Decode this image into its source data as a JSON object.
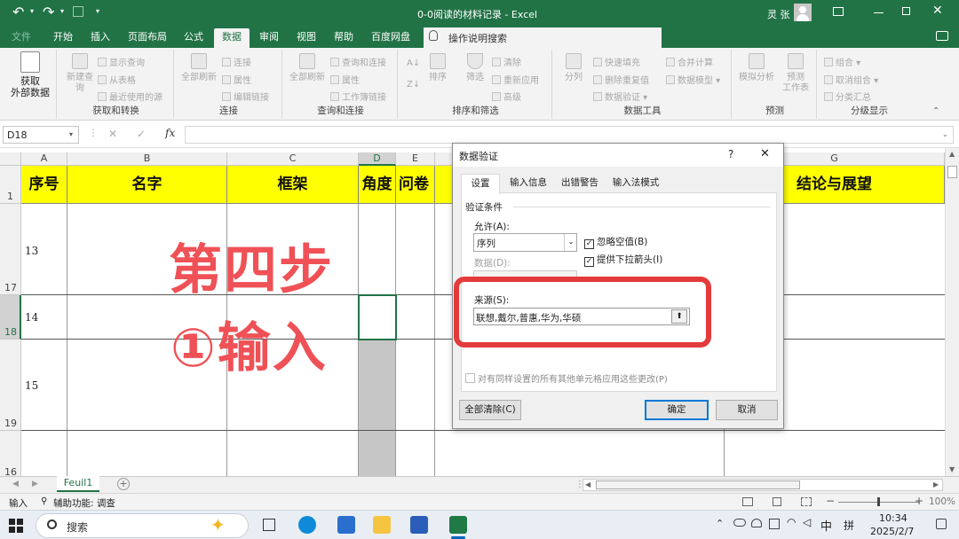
{
  "window": {
    "title": "0-0阅读的材料记录 - Excel",
    "user": "灵 张"
  },
  "quick_access": {
    "undo": "↶",
    "redo": "↷",
    "save": "▫"
  },
  "tabs": [
    {
      "label": "文件"
    },
    {
      "label": "开始"
    },
    {
      "label": "插入"
    },
    {
      "label": "页面布局"
    },
    {
      "label": "公式"
    },
    {
      "label": "数据"
    },
    {
      "label": "审阅"
    },
    {
      "label": "视图"
    },
    {
      "label": "帮助"
    },
    {
      "label": "百度网盘"
    }
  ],
  "tell_me": {
    "placeholder": "操作说明搜索"
  },
  "ribbon": {
    "get_data": {
      "label": "获取\n外部数据",
      "dropdown": "▾"
    },
    "get_transform": {
      "new_query": "新建查\n询",
      "show_queries": "显示查询",
      "from_table": "从表格",
      "recent_sources": "最近使用的源",
      "group": "获取和转换"
    },
    "connections": {
      "refresh_all": "全部刷新",
      "connections": "连接",
      "properties": "属性",
      "edit_links": "编辑链接",
      "group": "连接"
    },
    "queries": {
      "refresh_all": "全部刷新",
      "queries_connections": "查询和连接",
      "properties": "属性",
      "workbook_links": "工作簿链接",
      "group": "查询和连接"
    },
    "sort_filter": {
      "sort": "排序",
      "filter": "筛选",
      "clear": "清除",
      "reapply": "重新应用",
      "advanced": "高级",
      "group": "排序和筛选"
    },
    "data_tools": {
      "text_to_columns": "分列",
      "flash_fill": "快速填充",
      "remove_duplicates": "删除重复值",
      "data_validation": "数据验证",
      "consolidate": "合并计算",
      "data_model": "数据模型",
      "group": "数据工具"
    },
    "forecast": {
      "what_if": "模拟分析",
      "forecast_sheet": "预测\n工作表",
      "group": "预测"
    },
    "outline": {
      "group_btn": "组合",
      "ungroup": "取消组合",
      "subtotal": "分类汇总",
      "group": "分级显示"
    }
  },
  "formula_bar": {
    "name_box": "D18",
    "fx": "fx",
    "cancel": "✕",
    "enter": "✓"
  },
  "sheet": {
    "columns": [
      "A",
      "B",
      "C",
      "D",
      "E",
      "G"
    ],
    "headers": [
      "序号",
      "名字",
      "框架",
      "角度",
      "问卷",
      "结论与展望"
    ],
    "row_numbers": [
      "1",
      "17",
      "18",
      "19",
      "16"
    ],
    "cell_values": [
      "13",
      "14",
      "15"
    ]
  },
  "overlay": {
    "line1": "第四步",
    "line2": "①输入"
  },
  "dialog": {
    "title": "数据验证",
    "help": "?",
    "close": "✕",
    "tabs": [
      "设置",
      "输入信息",
      "出错警告",
      "输入法模式"
    ],
    "section": "验证条件",
    "allow_label": "允许(A):",
    "allow_value": "序列",
    "data_label": "数据(D):",
    "ignore_blank": "忽略空值(B)",
    "dropdown": "提供下拉箭头(I)",
    "source_label": "来源(S):",
    "source_value": "联想,戴尔,普惠,华为,华硕",
    "apply_all": "对有同样设置的所有其他单元格应用这些更改(P)",
    "clear_all": "全部清除(C)",
    "ok": "确定",
    "cancel": "取消"
  },
  "sheet_tabs": {
    "active": "Feuil1",
    "add": "+"
  },
  "status": {
    "mode": "输入",
    "accessibility": "辅助功能: 调查",
    "zoom": "100%"
  },
  "taskbar": {
    "search": "搜索",
    "ime": "中",
    "layout": "拼",
    "time": "10:34",
    "date": "2025/2/7"
  },
  "colors": {
    "excel_green": "#217346",
    "header_yellow": "#ffff00",
    "overlay_red": "#ef5156",
    "highlight_red": "#e33b3b"
  }
}
